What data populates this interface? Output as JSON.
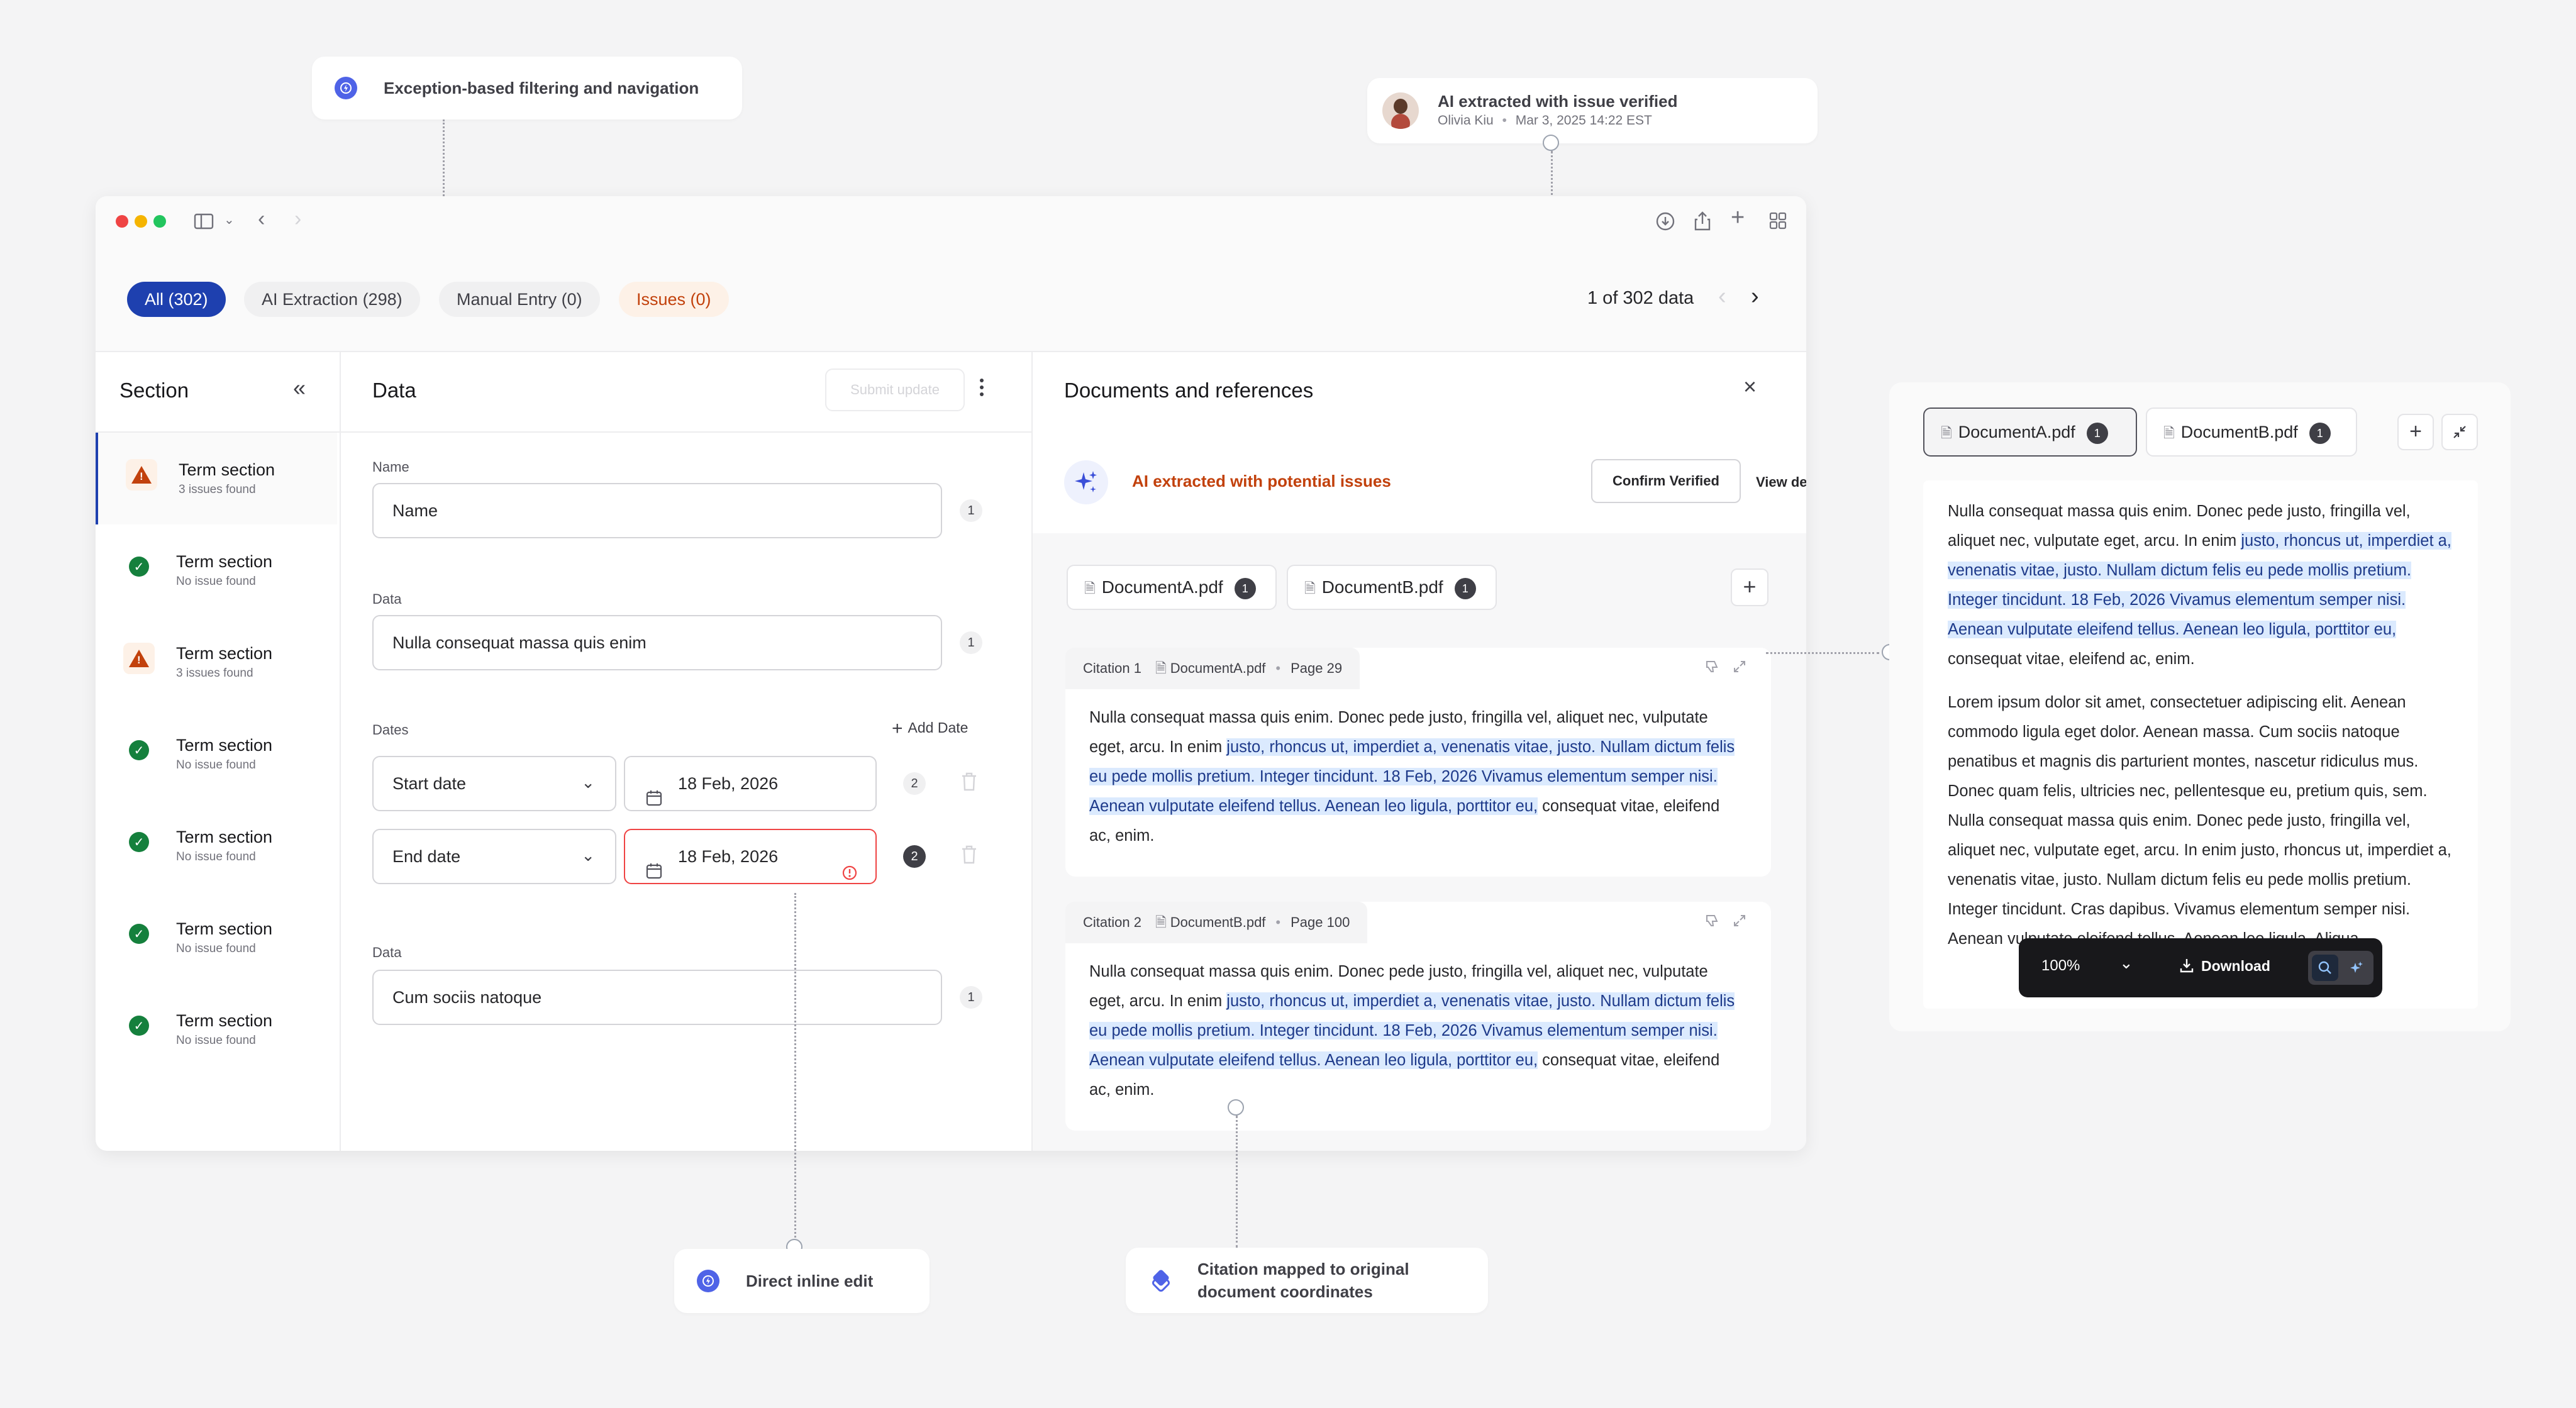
{
  "callouts": {
    "filtering": "Exception-based filtering and navigation",
    "verified_title": "AI extracted with issue verified",
    "verified_user": "Olivia Kiu",
    "verified_time": "Mar 3, 2025 14:22 EST",
    "inline_edit": "Direct inline edit",
    "citation_line1": "Citation mapped to original",
    "citation_line2": "document coordinates"
  },
  "filters": {
    "all": "All (302)",
    "ai": "AI Extraction (298)",
    "manual": "Manual Entry (0)",
    "issues": "Issues (0)",
    "pager": "1 of 302 data"
  },
  "section": {
    "title": "Section",
    "items": [
      {
        "title": "Term section",
        "sub": "3 issues found",
        "status": "warning"
      },
      {
        "title": "Term section",
        "sub": "No issue found",
        "status": "ok"
      },
      {
        "title": "Term section",
        "sub": "3 issues found",
        "status": "warning"
      },
      {
        "title": "Term section",
        "sub": "No issue found",
        "status": "ok"
      },
      {
        "title": "Term section",
        "sub": "No issue found",
        "status": "ok"
      },
      {
        "title": "Term section",
        "sub": "No issue found",
        "status": "ok"
      },
      {
        "title": "Term section",
        "sub": "No issue found",
        "status": "ok"
      }
    ]
  },
  "data": {
    "title": "Data",
    "submit": "Submit update",
    "name_label": "Name",
    "name_value": "Name",
    "name_count": "1",
    "data_label": "Data",
    "data_value": "Nulla consequat massa quis enim",
    "data_count": "1",
    "dates_label": "Dates",
    "add_date": "Add Date",
    "start_select": "Start date",
    "start_value": "18 Feb, 2026",
    "start_count": "2",
    "end_select": "End date",
    "end_value": "18 Feb, 2026",
    "end_count": "2",
    "data2_label": "Data",
    "data2_value": "Cum sociis natoque",
    "data2_count": "1"
  },
  "docs": {
    "title": "Documents and references",
    "ai_status": "AI extracted with potential issues",
    "confirm": "Confirm Verified",
    "view_details": "View details",
    "tab_a": "DocumentA.pdf",
    "tab_a_count": "1",
    "tab_b": "DocumentB.pdf",
    "tab_b_count": "1",
    "citations": [
      {
        "label": "Citation 1",
        "file": "DocumentA.pdf",
        "page": "Page 29",
        "pre": "Nulla consequat massa quis enim. Donec pede justo, fringilla vel, aliquet nec, vulputate eget, arcu. In enim ",
        "highlight": "justo, rhoncus ut, imperdiet a, venenatis vitae, justo. Nullam dictum felis eu pede mollis pretium. Integer tincidunt. 18 Feb, 2026 Vivamus elementum semper nisi. Aenean vulputate eleifend tellus. Aenean leo ligula, porttitor eu,",
        "post": " consequat vitae, eleifend ac, enim."
      },
      {
        "label": "Citation 2",
        "file": "DocumentB.pdf",
        "page": "Page 100",
        "pre": "Nulla consequat massa quis enim. Donec pede justo, fringilla vel, aliquet nec, vulputate eget, arcu. In enim ",
        "highlight": "justo, rhoncus ut, imperdiet a, venenatis vitae, justo. Nullam dictum felis eu pede mollis pretium. Integer tincidunt. 18 Feb, 2026 Vivamus elementum semper nisi. Aenean vulputate eleifend tellus. Aenean leo ligula, porttitor eu,",
        "post": " consequat vitae, eleifend ac, enim."
      }
    ]
  },
  "viewer": {
    "tab_a": "DocumentA.pdf",
    "tab_a_count": "1",
    "tab_b": "DocumentB.pdf",
    "tab_b_count": "1",
    "p1_pre": "Nulla consequat massa quis enim. Donec pede justo, fringilla vel, aliquet nec, vulputate eget, arcu. In enim ",
    "p1_highlight": "justo, rhoncus ut, imperdiet a, venenatis vitae, justo. Nullam dictum felis eu pede mollis pretium. Integer tincidunt. 18 Feb, 2026 Vivamus elementum semper nisi. Aenean vulputate eleifend tellus. Aenean leo ligula, porttitor eu,",
    "p1_post": " consequat vitae, eleifend ac, enim.",
    "p2_a": "Lorem ipsum dolor sit amet, consectetuer adipiscing elit. Aenean commodo ligula eget dolor. Aenean massa. Cum sociis natoque penatibus et magnis dis parturient montes, nascetur ridiculus mus. Donec quam felis, ultricies nec, pellentesque eu, pretium quis, sem. Nulla consequat massa quis enim. Donec pede justo, fringilla vel, aliquet nec, vulputate eget, arcu. In enim justo, rhoncus ut, imperdiet a, venenatis vitae, justo. Nullam dictum felis eu pede mollis pretium. Integer tincidunt. Cras dapibus. Vivamus elementum semper nisi. Aenean vulputate eleifend tellus. Aenean leo ligula,",
    "p2_tail": "Aliqua...",
    "zoom": "100%",
    "download": "Download"
  },
  "colors": {
    "accent": "#1e40af",
    "issue_orange": "#c2410c",
    "ok_green": "#15803d",
    "highlight": "#dbeafe"
  }
}
